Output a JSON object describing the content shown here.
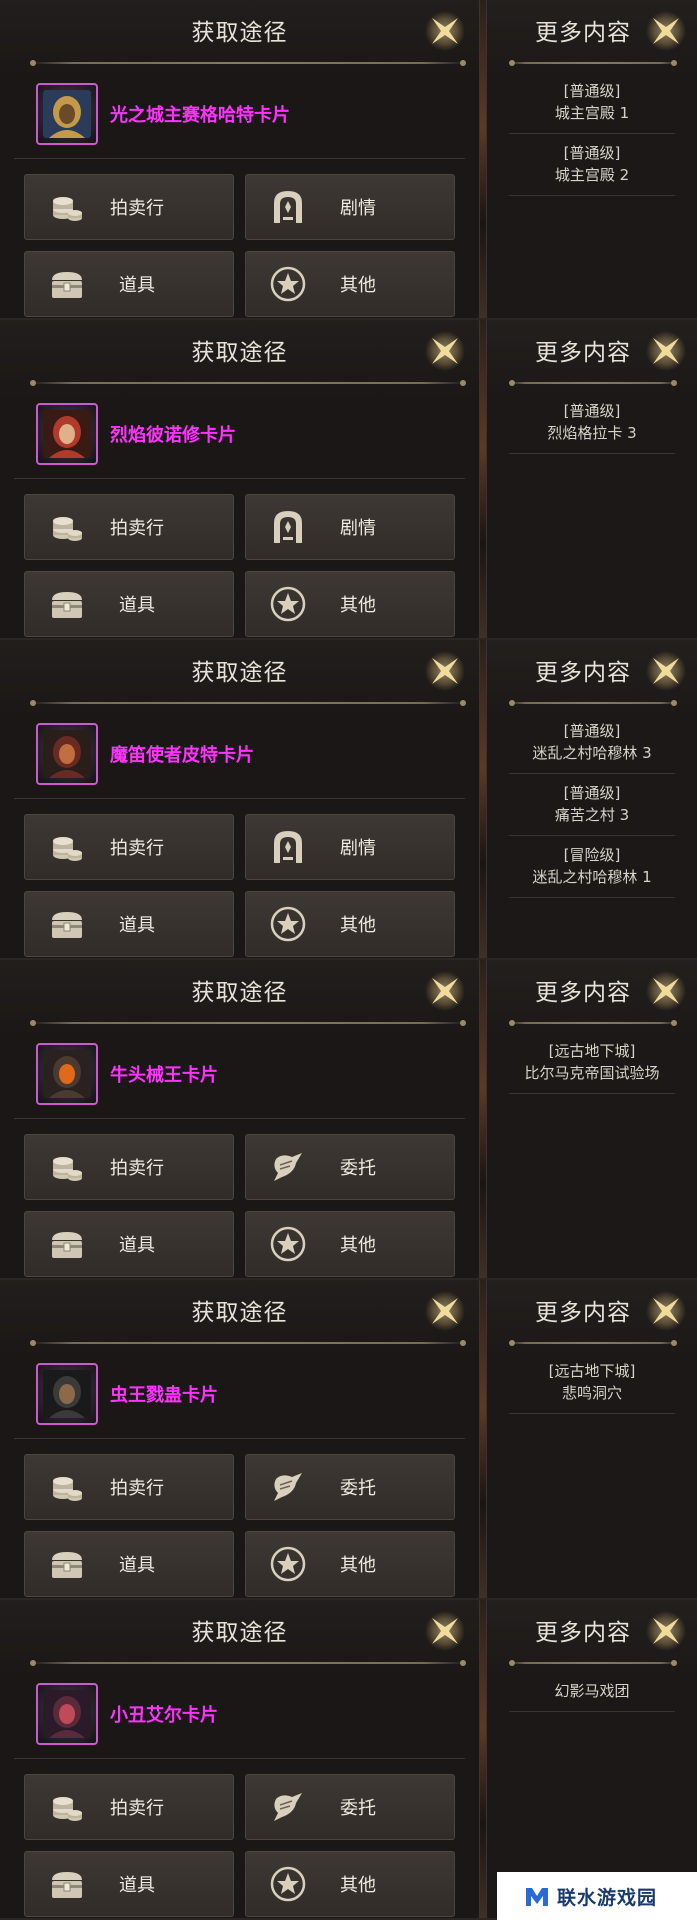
{
  "panels": [
    {
      "title": "获取途径",
      "more_title": "更多内容",
      "item_name": "光之城主赛格哈特卡片",
      "portrait_icon": "armored-knight-portrait",
      "buttons": [
        {
          "label": "拍卖行",
          "icon": "coin-stack-icon"
        },
        {
          "label": "剧情",
          "icon": "gate-arch-icon"
        },
        {
          "label": "道具",
          "icon": "treasure-chest-icon"
        },
        {
          "label": "其他",
          "icon": "star-circle-icon"
        }
      ],
      "more": [
        {
          "level": "[普通级]",
          "place": "城主宫殿 1"
        },
        {
          "level": "[普通级]",
          "place": "城主宫殿 2"
        }
      ]
    },
    {
      "title": "获取途径",
      "more_title": "更多内容",
      "item_name": "烈焰彼诺修卡片",
      "portrait_icon": "red-haired-warrior-portrait",
      "buttons": [
        {
          "label": "拍卖行",
          "icon": "coin-stack-icon"
        },
        {
          "label": "剧情",
          "icon": "gate-arch-icon"
        },
        {
          "label": "道具",
          "icon": "treasure-chest-icon"
        },
        {
          "label": "其他",
          "icon": "star-circle-icon"
        }
      ],
      "more": [
        {
          "level": "[普通级]",
          "place": "烈焰格拉卡 3"
        }
      ]
    },
    {
      "title": "获取途径",
      "more_title": "更多内容",
      "item_name": "魔笛使者皮特卡片",
      "portrait_icon": "dark-piper-portrait",
      "buttons": [
        {
          "label": "拍卖行",
          "icon": "coin-stack-icon"
        },
        {
          "label": "剧情",
          "icon": "gate-arch-icon"
        },
        {
          "label": "道具",
          "icon": "treasure-chest-icon"
        },
        {
          "label": "其他",
          "icon": "star-circle-icon"
        }
      ],
      "more": [
        {
          "level": "[普通级]",
          "place": "迷乱之村哈穆林 3"
        },
        {
          "level": "[普通级]",
          "place": "痛苦之村 3"
        },
        {
          "level": "[冒险级]",
          "place": "迷乱之村哈穆林 1"
        }
      ]
    },
    {
      "title": "获取途径",
      "more_title": "更多内容",
      "item_name": "牛头械王卡片",
      "portrait_icon": "mech-minotaur-portrait",
      "buttons": [
        {
          "label": "拍卖行",
          "icon": "coin-stack-icon"
        },
        {
          "label": "委托",
          "icon": "scroll-quill-icon"
        },
        {
          "label": "道具",
          "icon": "treasure-chest-icon"
        },
        {
          "label": "其他",
          "icon": "star-circle-icon"
        }
      ],
      "more": [
        {
          "level": "[远古地下城]",
          "place": "比尔马克帝国试验场"
        }
      ]
    },
    {
      "title": "获取途径",
      "more_title": "更多内容",
      "item_name": "虫王戮蛊卡片",
      "portrait_icon": "insect-king-portrait",
      "buttons": [
        {
          "label": "拍卖行",
          "icon": "coin-stack-icon"
        },
        {
          "label": "委托",
          "icon": "scroll-quill-icon"
        },
        {
          "label": "道具",
          "icon": "treasure-chest-icon"
        },
        {
          "label": "其他",
          "icon": "star-circle-icon"
        }
      ],
      "more": [
        {
          "level": "[远古地下城]",
          "place": "悲鸣洞穴"
        }
      ]
    },
    {
      "title": "获取途径",
      "more_title": "更多内容",
      "item_name": "小丑艾尔卡片",
      "portrait_icon": "clown-portrait",
      "buttons": [
        {
          "label": "拍卖行",
          "icon": "coin-stack-icon"
        },
        {
          "label": "委托",
          "icon": "scroll-quill-icon"
        },
        {
          "label": "道具",
          "icon": "treasure-chest-icon"
        },
        {
          "label": "其他",
          "icon": "star-circle-icon"
        }
      ],
      "more": [
        {
          "level": "",
          "place": "幻影马戏团"
        }
      ]
    }
  ],
  "watermark": {
    "text": "联水游戏园",
    "icon": "m-logo-icon"
  },
  "colors": {
    "item_name": "#ff33ff",
    "icon_border": "#c85cc8",
    "button_bg": "#3a3431"
  }
}
